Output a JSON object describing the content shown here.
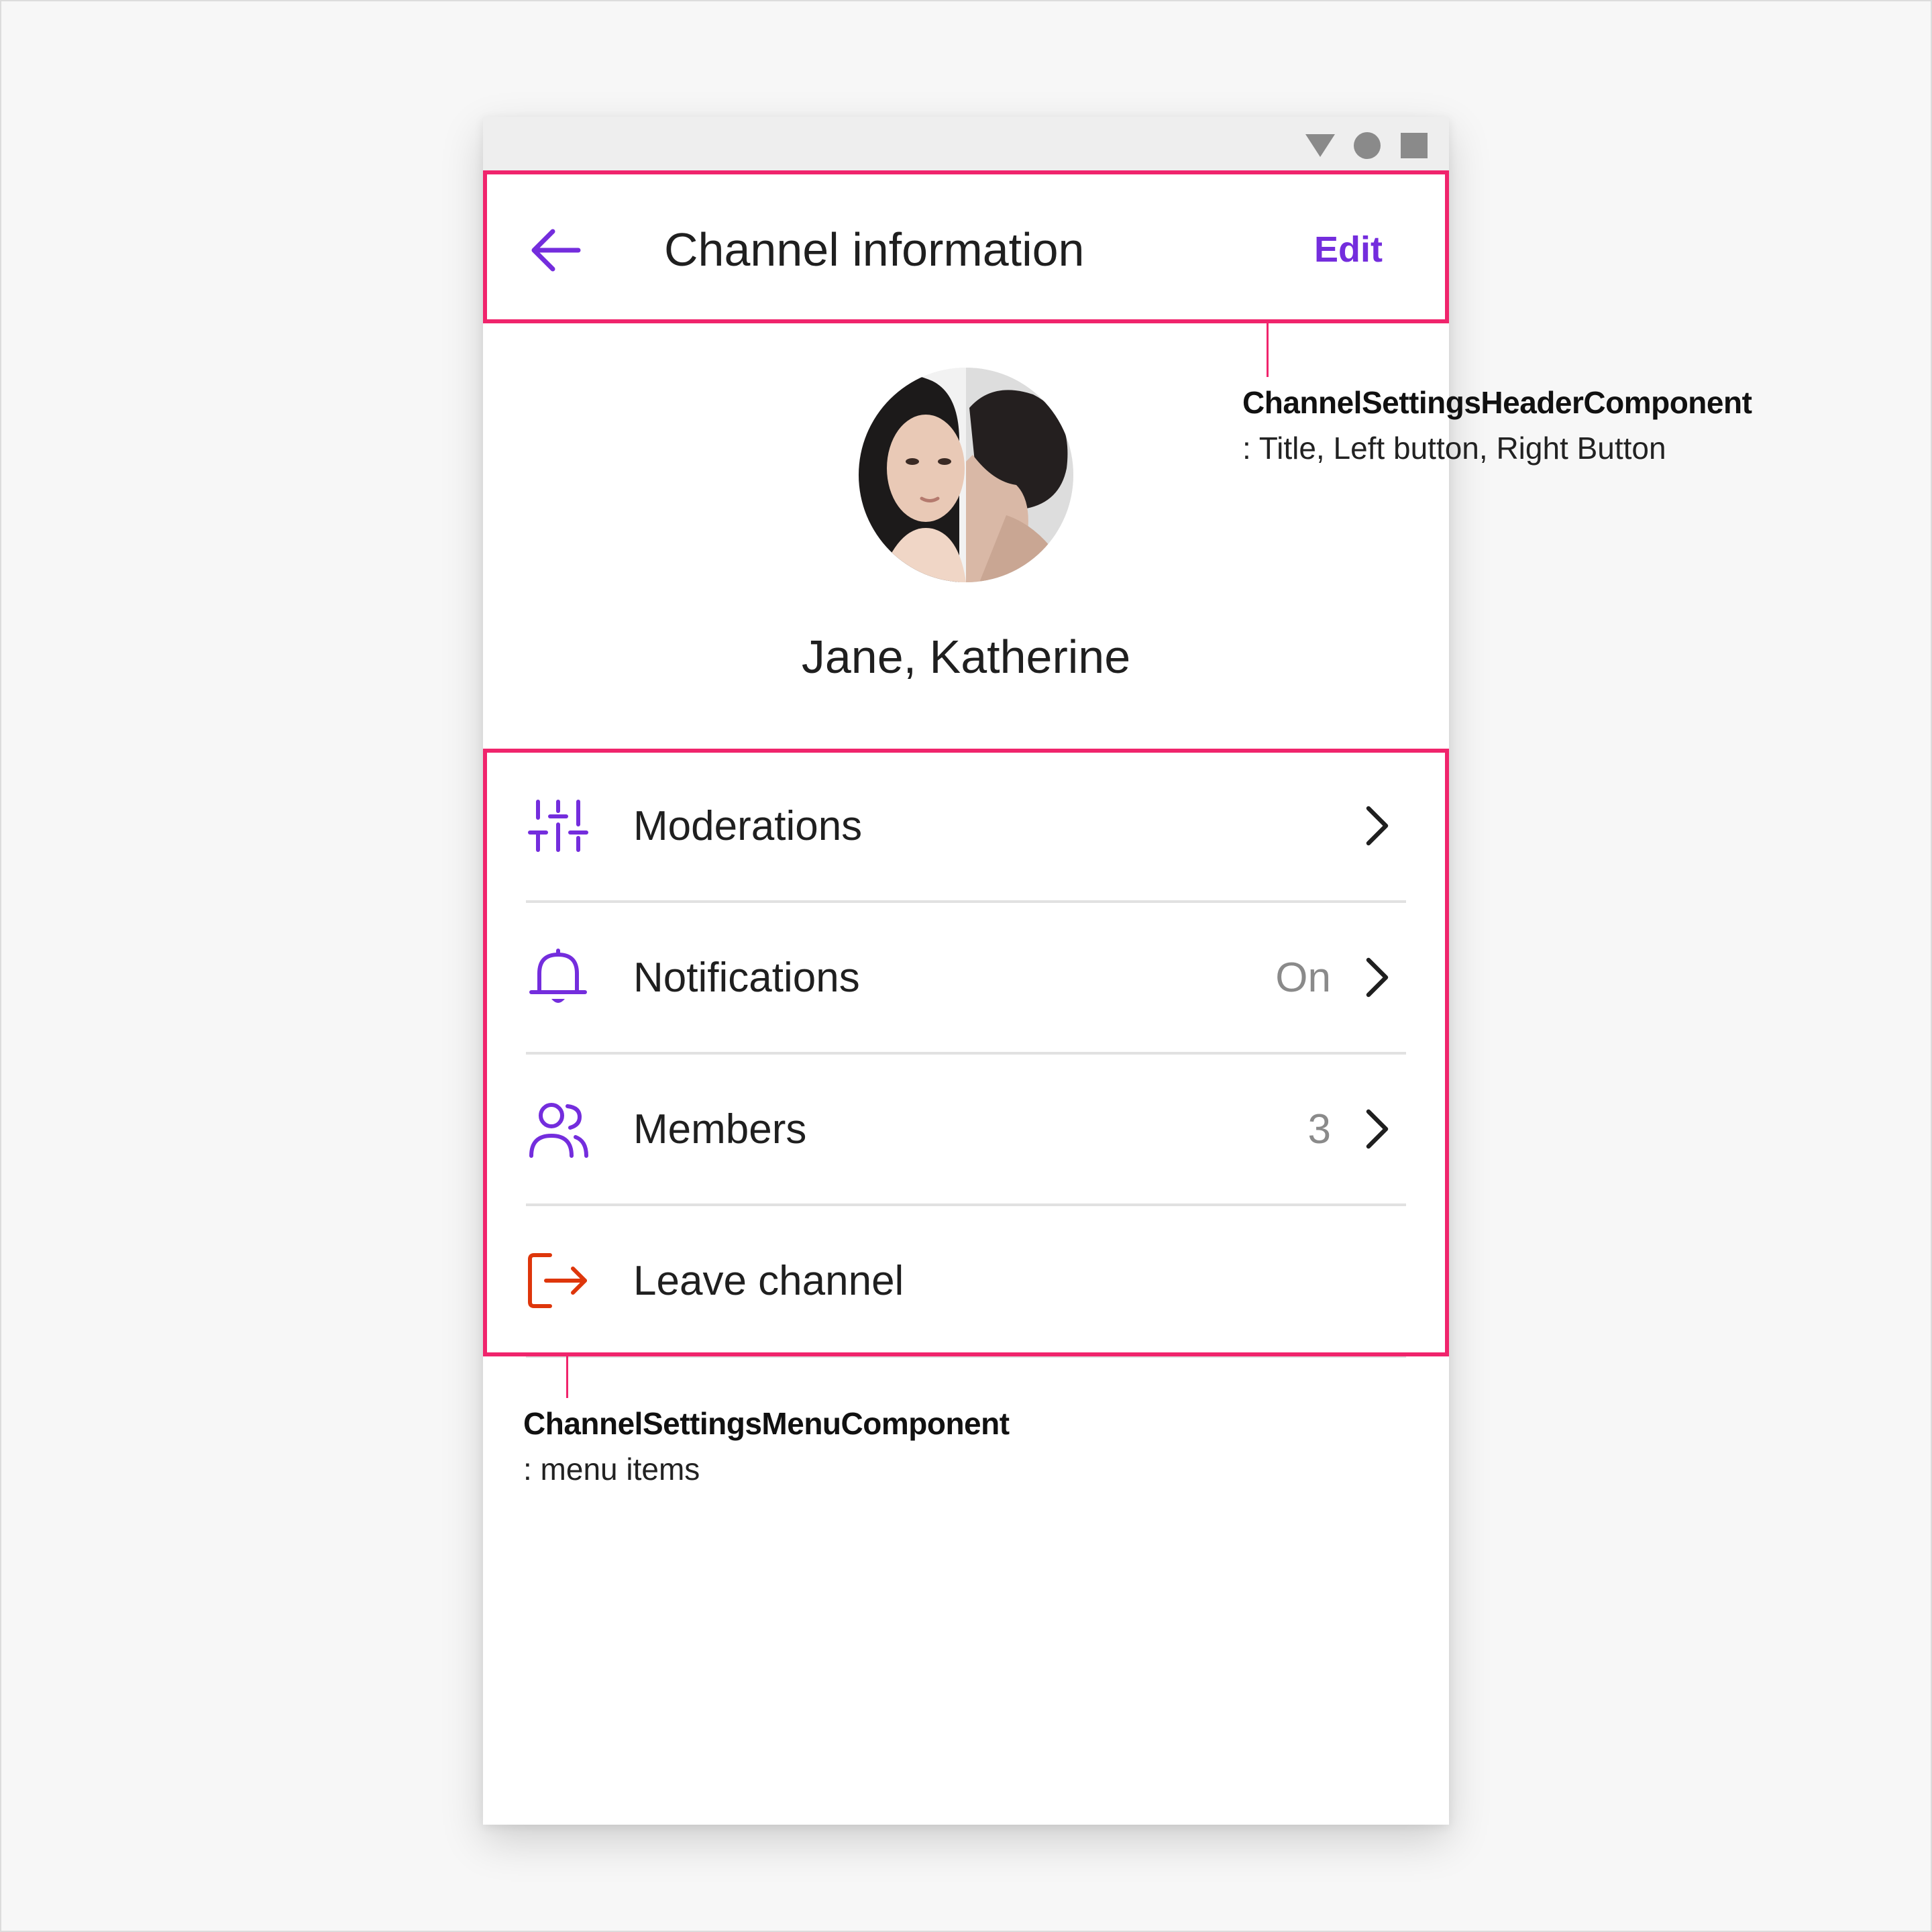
{
  "header": {
    "title": "Channel information",
    "right_button_label": "Edit"
  },
  "channel": {
    "name": "Jane, Katherine"
  },
  "menu": {
    "items": [
      {
        "label": "Moderations",
        "value": "",
        "icon": "sliders-icon",
        "has_chevron": true
      },
      {
        "label": "Notifications",
        "value": "On",
        "icon": "bell-icon",
        "has_chevron": true
      },
      {
        "label": "Members",
        "value": "3",
        "icon": "members-icon",
        "has_chevron": true
      },
      {
        "label": "Leave channel",
        "value": "",
        "icon": "leave-icon",
        "has_chevron": false
      }
    ]
  },
  "annotations": {
    "header_component": {
      "title": "ChannelSettingsHeaderComponent",
      "desc": ": Title, Left button, Right Button"
    },
    "menu_component": {
      "title": "ChannelSettingsMenuComponent",
      "desc": ": menu items"
    }
  },
  "colors": {
    "accent": "#742ddd",
    "danger": "#de360b",
    "highlight": "#f0246c",
    "secondary_text": "#8a8a8a"
  }
}
